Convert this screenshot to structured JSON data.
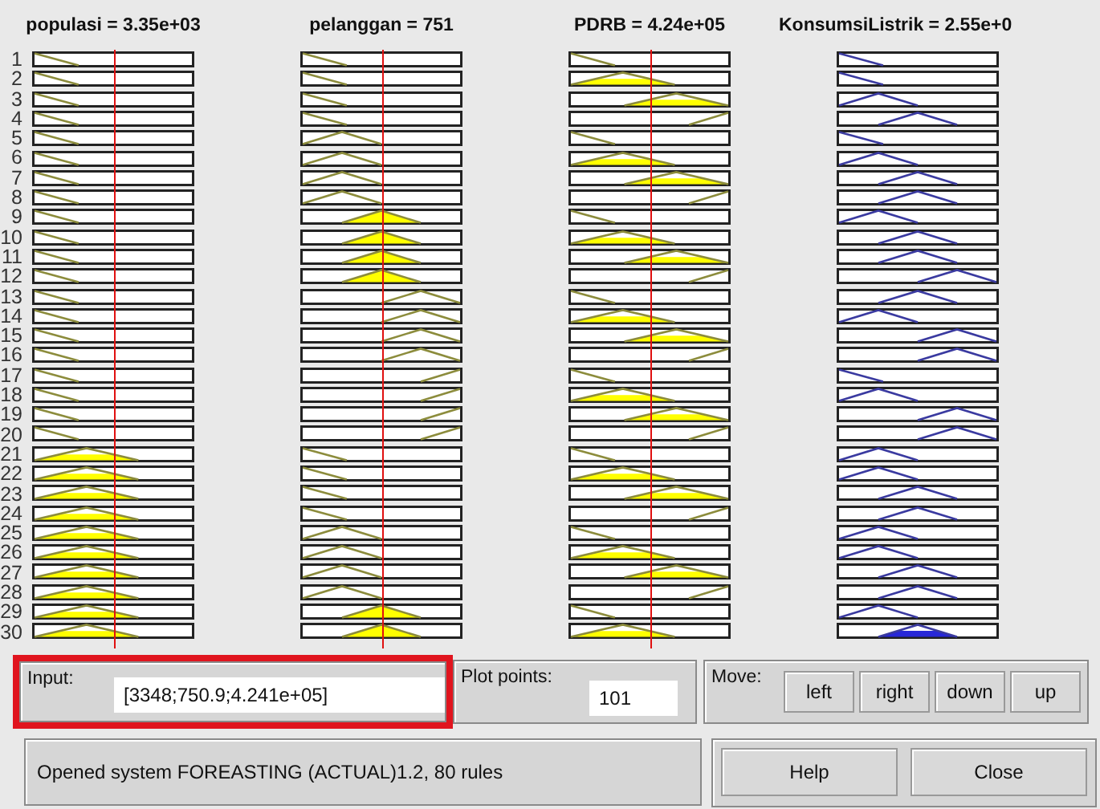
{
  "rule_numbers": [
    "1",
    "2",
    "3",
    "4",
    "5",
    "6",
    "7",
    "8",
    "9",
    "10",
    "11",
    "12",
    "13",
    "14",
    "15",
    "16",
    "17",
    "18",
    "19",
    "20",
    "21",
    "22",
    "23",
    "24",
    "25",
    "26",
    "27",
    "28",
    "29",
    "30"
  ],
  "variables": [
    {
      "title": "populasi = 3.35e+03",
      "kind": "input",
      "cells": [
        {
          "kind": "left",
          "fired": false
        },
        {
          "kind": "left",
          "fired": false
        },
        {
          "kind": "left",
          "fired": false
        },
        {
          "kind": "left",
          "fired": false
        },
        {
          "kind": "left",
          "fired": false
        },
        {
          "kind": "left",
          "fired": false
        },
        {
          "kind": "left",
          "fired": false
        },
        {
          "kind": "left",
          "fired": false
        },
        {
          "kind": "left",
          "fired": false
        },
        {
          "kind": "left",
          "fired": false
        },
        {
          "kind": "left",
          "fired": false
        },
        {
          "kind": "left",
          "fired": false
        },
        {
          "kind": "left",
          "fired": false
        },
        {
          "kind": "left",
          "fired": false
        },
        {
          "kind": "left",
          "fired": false
        },
        {
          "kind": "left",
          "fired": false
        },
        {
          "kind": "left",
          "fired": false
        },
        {
          "kind": "left",
          "fired": false
        },
        {
          "kind": "left",
          "fired": false
        },
        {
          "kind": "left",
          "fired": false
        },
        {
          "kind": "third",
          "fired": true
        },
        {
          "kind": "third",
          "fired": true
        },
        {
          "kind": "third",
          "fired": true
        },
        {
          "kind": "third",
          "fired": true
        },
        {
          "kind": "third",
          "fired": true
        },
        {
          "kind": "third",
          "fired": true
        },
        {
          "kind": "third",
          "fired": true
        },
        {
          "kind": "third",
          "fired": true
        },
        {
          "kind": "third",
          "fired": true
        },
        {
          "kind": "third",
          "fired": true
        }
      ]
    },
    {
      "title": "pelanggan = 751",
      "kind": "input",
      "cells": [
        {
          "kind": "left",
          "fired": false
        },
        {
          "kind": "left",
          "fired": false
        },
        {
          "kind": "left",
          "fired": false
        },
        {
          "kind": "left",
          "fired": false
        },
        {
          "kind": "quarter",
          "fired": false
        },
        {
          "kind": "quarter",
          "fired": false
        },
        {
          "kind": "quarter",
          "fired": false
        },
        {
          "kind": "quarter",
          "fired": false
        },
        {
          "kind": "center",
          "fired": true
        },
        {
          "kind": "center",
          "fired": true
        },
        {
          "kind": "center",
          "fired": true
        },
        {
          "kind": "center",
          "fired": true
        },
        {
          "kind": "threequarter",
          "fired": false
        },
        {
          "kind": "threequarter",
          "fired": false
        },
        {
          "kind": "threequarter",
          "fired": false
        },
        {
          "kind": "threequarter",
          "fired": false
        },
        {
          "kind": "right",
          "fired": false
        },
        {
          "kind": "right",
          "fired": false
        },
        {
          "kind": "right",
          "fired": false
        },
        {
          "kind": "right",
          "fired": false
        },
        {
          "kind": "left",
          "fired": false
        },
        {
          "kind": "left",
          "fired": false
        },
        {
          "kind": "left",
          "fired": false
        },
        {
          "kind": "left",
          "fired": false
        },
        {
          "kind": "quarter",
          "fired": false
        },
        {
          "kind": "quarter",
          "fired": false
        },
        {
          "kind": "quarter",
          "fired": false
        },
        {
          "kind": "quarter",
          "fired": false
        },
        {
          "kind": "center",
          "fired": true
        },
        {
          "kind": "center",
          "fired": true
        }
      ]
    },
    {
      "title": "PDRB = 4.24e+05",
      "kind": "input",
      "cells": [
        {
          "kind": "left",
          "fired": false
        },
        {
          "kind": "third",
          "fired": true
        },
        {
          "kind": "twothirds",
          "fired": true
        },
        {
          "kind": "right",
          "fired": false
        },
        {
          "kind": "left",
          "fired": false
        },
        {
          "kind": "third",
          "fired": true
        },
        {
          "kind": "twothirds",
          "fired": true
        },
        {
          "kind": "right",
          "fired": false
        },
        {
          "kind": "left",
          "fired": false
        },
        {
          "kind": "third",
          "fired": true
        },
        {
          "kind": "twothirds",
          "fired": true
        },
        {
          "kind": "right",
          "fired": false
        },
        {
          "kind": "left",
          "fired": false
        },
        {
          "kind": "third",
          "fired": true
        },
        {
          "kind": "twothirds",
          "fired": true
        },
        {
          "kind": "right",
          "fired": false
        },
        {
          "kind": "left",
          "fired": false
        },
        {
          "kind": "third",
          "fired": true
        },
        {
          "kind": "twothirds",
          "fired": true
        },
        {
          "kind": "right",
          "fired": false
        },
        {
          "kind": "left",
          "fired": false
        },
        {
          "kind": "third",
          "fired": true
        },
        {
          "kind": "twothirds",
          "fired": true
        },
        {
          "kind": "right",
          "fired": false
        },
        {
          "kind": "left",
          "fired": false
        },
        {
          "kind": "third",
          "fired": true
        },
        {
          "kind": "twothirds",
          "fired": true
        },
        {
          "kind": "right",
          "fired": false
        },
        {
          "kind": "left",
          "fired": false
        },
        {
          "kind": "third",
          "fired": true
        }
      ]
    },
    {
      "title": "KonsumsiListrik = 2.55e+0",
      "kind": "output",
      "cells": [
        {
          "kind": "left",
          "fired": false
        },
        {
          "kind": "left",
          "fired": false
        },
        {
          "kind": "quarter",
          "fired": false
        },
        {
          "kind": "center",
          "fired": false
        },
        {
          "kind": "left",
          "fired": false
        },
        {
          "kind": "quarter",
          "fired": false
        },
        {
          "kind": "center",
          "fired": false
        },
        {
          "kind": "center",
          "fired": false
        },
        {
          "kind": "quarter",
          "fired": false
        },
        {
          "kind": "center",
          "fired": false
        },
        {
          "kind": "center",
          "fired": false
        },
        {
          "kind": "threequarter",
          "fired": false
        },
        {
          "kind": "center",
          "fired": false
        },
        {
          "kind": "quarter",
          "fired": false
        },
        {
          "kind": "threequarter",
          "fired": false
        },
        {
          "kind": "threequarter",
          "fired": false
        },
        {
          "kind": "left",
          "fired": false
        },
        {
          "kind": "quarter",
          "fired": false
        },
        {
          "kind": "threequarter",
          "fired": false
        },
        {
          "kind": "threequarter",
          "fired": false
        },
        {
          "kind": "quarter",
          "fired": false
        },
        {
          "kind": "quarter",
          "fired": false
        },
        {
          "kind": "center",
          "fired": false
        },
        {
          "kind": "center",
          "fired": false
        },
        {
          "kind": "quarter",
          "fired": false
        },
        {
          "kind": "quarter",
          "fired": false
        },
        {
          "kind": "center",
          "fired": false
        },
        {
          "kind": "center",
          "fired": false
        },
        {
          "kind": "quarter",
          "fired": false
        },
        {
          "kind": "center",
          "fired": true
        }
      ]
    }
  ],
  "input_panel": {
    "label": "Input:",
    "value": "[3348;750.9;4.241e+05]",
    "highlighted": true
  },
  "plot_points": {
    "label": "Plot points:",
    "value": "101"
  },
  "move": {
    "label": "Move:",
    "buttons": [
      "left",
      "right",
      "down",
      "up"
    ]
  },
  "status": "Opened system FOREASTING (ACTUAL)1.2, 80 rules",
  "buttons": [
    "Help",
    "Close"
  ]
}
